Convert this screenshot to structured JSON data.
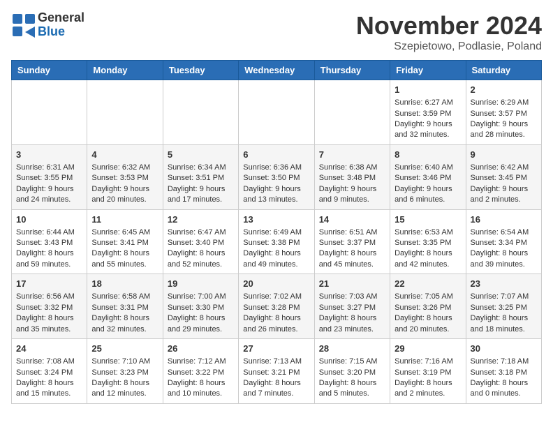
{
  "logo": {
    "text_general": "General",
    "text_blue": "Blue"
  },
  "title": "November 2024",
  "location": "Szepietowo, Podlasie, Poland",
  "headers": [
    "Sunday",
    "Monday",
    "Tuesday",
    "Wednesday",
    "Thursday",
    "Friday",
    "Saturday"
  ],
  "weeks": [
    [
      {
        "day": "",
        "info": ""
      },
      {
        "day": "",
        "info": ""
      },
      {
        "day": "",
        "info": ""
      },
      {
        "day": "",
        "info": ""
      },
      {
        "day": "",
        "info": ""
      },
      {
        "day": "1",
        "info": "Sunrise: 6:27 AM\nSunset: 3:59 PM\nDaylight: 9 hours\nand 32 minutes."
      },
      {
        "day": "2",
        "info": "Sunrise: 6:29 AM\nSunset: 3:57 PM\nDaylight: 9 hours\nand 28 minutes."
      }
    ],
    [
      {
        "day": "3",
        "info": "Sunrise: 6:31 AM\nSunset: 3:55 PM\nDaylight: 9 hours\nand 24 minutes."
      },
      {
        "day": "4",
        "info": "Sunrise: 6:32 AM\nSunset: 3:53 PM\nDaylight: 9 hours\nand 20 minutes."
      },
      {
        "day": "5",
        "info": "Sunrise: 6:34 AM\nSunset: 3:51 PM\nDaylight: 9 hours\nand 17 minutes."
      },
      {
        "day": "6",
        "info": "Sunrise: 6:36 AM\nSunset: 3:50 PM\nDaylight: 9 hours\nand 13 minutes."
      },
      {
        "day": "7",
        "info": "Sunrise: 6:38 AM\nSunset: 3:48 PM\nDaylight: 9 hours\nand 9 minutes."
      },
      {
        "day": "8",
        "info": "Sunrise: 6:40 AM\nSunset: 3:46 PM\nDaylight: 9 hours\nand 6 minutes."
      },
      {
        "day": "9",
        "info": "Sunrise: 6:42 AM\nSunset: 3:45 PM\nDaylight: 9 hours\nand 2 minutes."
      }
    ],
    [
      {
        "day": "10",
        "info": "Sunrise: 6:44 AM\nSunset: 3:43 PM\nDaylight: 8 hours\nand 59 minutes."
      },
      {
        "day": "11",
        "info": "Sunrise: 6:45 AM\nSunset: 3:41 PM\nDaylight: 8 hours\nand 55 minutes."
      },
      {
        "day": "12",
        "info": "Sunrise: 6:47 AM\nSunset: 3:40 PM\nDaylight: 8 hours\nand 52 minutes."
      },
      {
        "day": "13",
        "info": "Sunrise: 6:49 AM\nSunset: 3:38 PM\nDaylight: 8 hours\nand 49 minutes."
      },
      {
        "day": "14",
        "info": "Sunrise: 6:51 AM\nSunset: 3:37 PM\nDaylight: 8 hours\nand 45 minutes."
      },
      {
        "day": "15",
        "info": "Sunrise: 6:53 AM\nSunset: 3:35 PM\nDaylight: 8 hours\nand 42 minutes."
      },
      {
        "day": "16",
        "info": "Sunrise: 6:54 AM\nSunset: 3:34 PM\nDaylight: 8 hours\nand 39 minutes."
      }
    ],
    [
      {
        "day": "17",
        "info": "Sunrise: 6:56 AM\nSunset: 3:32 PM\nDaylight: 8 hours\nand 35 minutes."
      },
      {
        "day": "18",
        "info": "Sunrise: 6:58 AM\nSunset: 3:31 PM\nDaylight: 8 hours\nand 32 minutes."
      },
      {
        "day": "19",
        "info": "Sunrise: 7:00 AM\nSunset: 3:30 PM\nDaylight: 8 hours\nand 29 minutes."
      },
      {
        "day": "20",
        "info": "Sunrise: 7:02 AM\nSunset: 3:28 PM\nDaylight: 8 hours\nand 26 minutes."
      },
      {
        "day": "21",
        "info": "Sunrise: 7:03 AM\nSunset: 3:27 PM\nDaylight: 8 hours\nand 23 minutes."
      },
      {
        "day": "22",
        "info": "Sunrise: 7:05 AM\nSunset: 3:26 PM\nDaylight: 8 hours\nand 20 minutes."
      },
      {
        "day": "23",
        "info": "Sunrise: 7:07 AM\nSunset: 3:25 PM\nDaylight: 8 hours\nand 18 minutes."
      }
    ],
    [
      {
        "day": "24",
        "info": "Sunrise: 7:08 AM\nSunset: 3:24 PM\nDaylight: 8 hours\nand 15 minutes."
      },
      {
        "day": "25",
        "info": "Sunrise: 7:10 AM\nSunset: 3:23 PM\nDaylight: 8 hours\nand 12 minutes."
      },
      {
        "day": "26",
        "info": "Sunrise: 7:12 AM\nSunset: 3:22 PM\nDaylight: 8 hours\nand 10 minutes."
      },
      {
        "day": "27",
        "info": "Sunrise: 7:13 AM\nSunset: 3:21 PM\nDaylight: 8 hours\nand 7 minutes."
      },
      {
        "day": "28",
        "info": "Sunrise: 7:15 AM\nSunset: 3:20 PM\nDaylight: 8 hours\nand 5 minutes."
      },
      {
        "day": "29",
        "info": "Sunrise: 7:16 AM\nSunset: 3:19 PM\nDaylight: 8 hours\nand 2 minutes."
      },
      {
        "day": "30",
        "info": "Sunrise: 7:18 AM\nSunset: 3:18 PM\nDaylight: 8 hours\nand 0 minutes."
      }
    ]
  ]
}
